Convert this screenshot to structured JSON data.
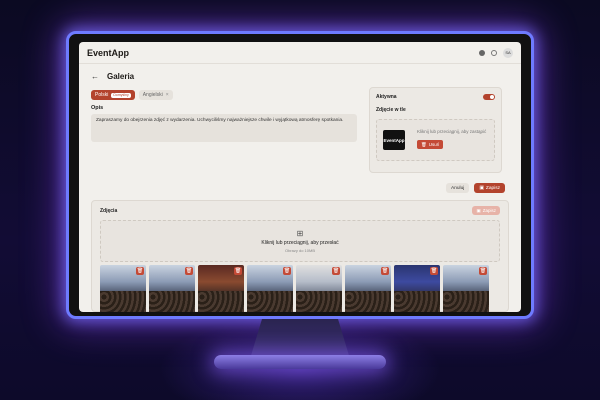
{
  "app": {
    "brand": "EventApp",
    "avatar_initials": "SA"
  },
  "page": {
    "title": "Galeria",
    "back_icon": "arrow-left-icon"
  },
  "languages": [
    {
      "label": "Polski",
      "badge": "Domyślny",
      "active": true
    },
    {
      "label": "Angielski",
      "active": false
    }
  ],
  "description": {
    "label": "Opis",
    "text": "Zapraszamy do obejrzenia zdjęć z wydarzenia. Uchwyciliśmy najważniejsze chwile i wyjątkową atmosferę spotkania."
  },
  "settings_card": {
    "active_label": "Aktywna",
    "active_on": true,
    "background_label": "Zdjęcie w tle",
    "logo_text": "EventApp",
    "drop_text": "Kliknij lub przeciągnij, aby zastąpić",
    "remove_label": "Usuń"
  },
  "actions": {
    "cancel_label": "Anuluj",
    "save_label": "Zapisz"
  },
  "gallery": {
    "label": "Zdjęcia",
    "save_label": "Zapisz",
    "drop_title": "Kliknij lub przeciągnij, aby przesłać",
    "drop_hint": "Obrazy do 10MB",
    "photos_count": 8
  },
  "colors": {
    "accent": "#b3432d",
    "screen_bg": "#f2f0ec",
    "glow": "#6e7bff"
  }
}
